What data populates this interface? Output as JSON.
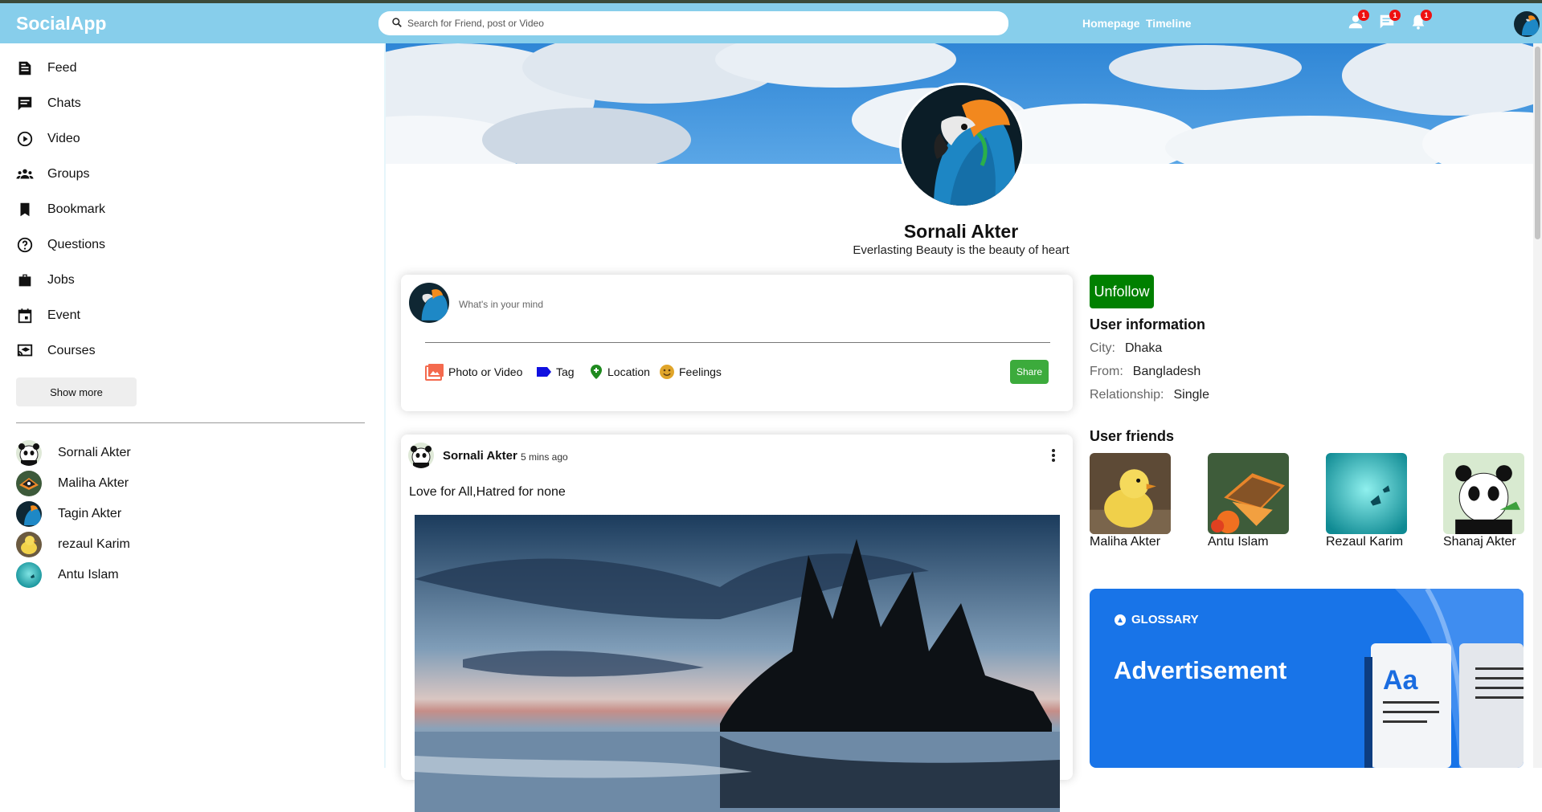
{
  "app": {
    "title": "SocialApp"
  },
  "search": {
    "placeholder": "Search for Friend, post or Video"
  },
  "nav": {
    "links": [
      "Homepage",
      "Timeline"
    ]
  },
  "notifications": {
    "friends_count": "1",
    "messages_count": "1",
    "alerts_count": "1"
  },
  "sidebar": {
    "items": [
      {
        "label": "Feed",
        "icon": "feed-icon"
      },
      {
        "label": "Chats",
        "icon": "chat-icon"
      },
      {
        "label": "Video",
        "icon": "play-circle-icon"
      },
      {
        "label": "Groups",
        "icon": "groups-icon"
      },
      {
        "label": "Bookmark",
        "icon": "bookmark-icon"
      },
      {
        "label": "Questions",
        "icon": "help-icon"
      },
      {
        "label": "Jobs",
        "icon": "briefcase-icon"
      },
      {
        "label": "Event",
        "icon": "calendar-icon"
      },
      {
        "label": "Courses",
        "icon": "school-icon"
      }
    ],
    "show_more": "Show more",
    "friends": [
      "Sornali Akter",
      "Maliha Akter",
      "Tagin Akter",
      "rezaul Karim",
      "Antu Islam"
    ]
  },
  "profile": {
    "name": "Sornali Akter",
    "description": "Everlasting Beauty is the beauty of heart"
  },
  "share": {
    "placeholder": "What's in your mind",
    "options": [
      "Photo or Video",
      "Tag",
      "Location",
      "Feelings"
    ],
    "button": "Share"
  },
  "post": {
    "author": "Sornali Akter",
    "time": "5 mins ago",
    "text": "Love for All,Hatred for none"
  },
  "right": {
    "unfollow": "Unfollow",
    "user_info_title": "User information",
    "info": [
      {
        "key": "City:",
        "value": "Dhaka"
      },
      {
        "key": "From:",
        "value": "Bangladesh"
      },
      {
        "key": "Relationship:",
        "value": "Single"
      }
    ],
    "friends_title": "User friends",
    "friends": [
      "Maliha Akter",
      "Antu Islam",
      "Rezaul Karim",
      "Shanaj Akter"
    ],
    "ad_brand": "GLOSSARY",
    "ad_title": "Advertisement"
  },
  "colors": {
    "topbar": "#87ceeb",
    "unfollow": "#008000",
    "share": "#3cab3c",
    "badge": "#e11111",
    "ad": "#1874e8"
  }
}
